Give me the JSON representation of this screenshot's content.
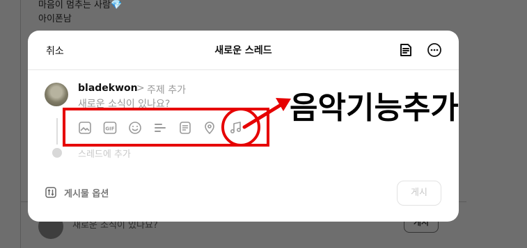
{
  "background": {
    "feed_line_1": "마음이 멈추는 사람💎",
    "feed_line_2": "아이폰남",
    "compose_placeholder": "새로운 소식이 있나요?",
    "post_label": "게시"
  },
  "modal": {
    "cancel_label": "취소",
    "title": "새로운 스레드",
    "header_icons": [
      "document-icon",
      "more-icon"
    ],
    "username": "bladekwon",
    "topic_separator": ">",
    "topic_placeholder": "주제 추가",
    "compose_placeholder": "새로운 소식이 있나요?",
    "tools": [
      "image-icon",
      "gif-icon",
      "emoji-icon",
      "poll-icon",
      "document-icon",
      "location-icon",
      "music-icon"
    ],
    "add_thread_label": "스레드에 추가",
    "options_label": "게시물 옵션",
    "post_label": "게시"
  },
  "annotation": {
    "text": "음악기능추가",
    "color": "#e60000"
  }
}
